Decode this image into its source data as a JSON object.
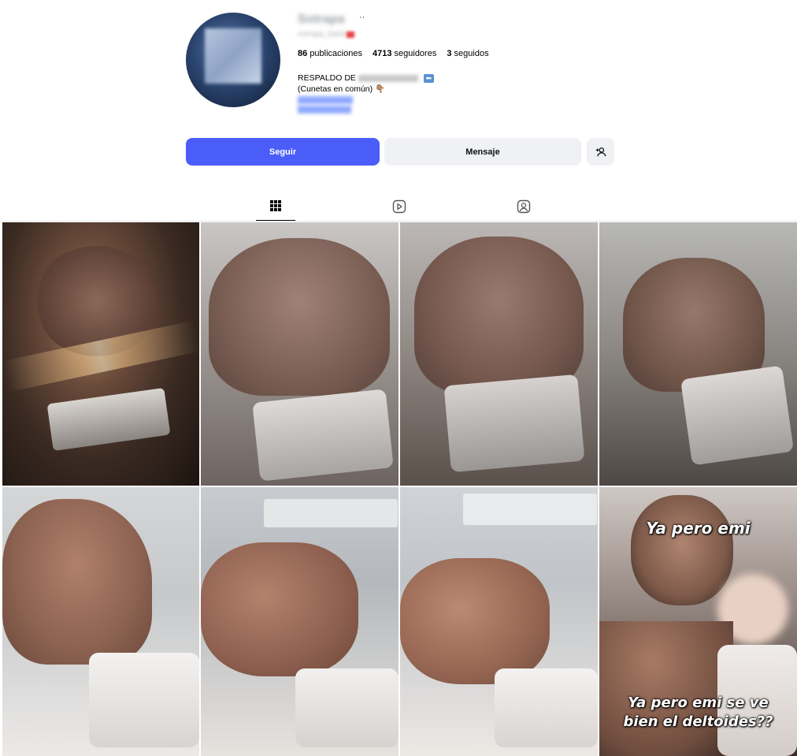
{
  "profile": {
    "username": "Sotrapa",
    "more_icon": "more-dots-icon",
    "handle": "sotrapa_backup",
    "stats": {
      "posts_count": "86",
      "posts_label": "publicaciones",
      "followers_count": "4713",
      "followers_label": "seguidores",
      "following_count": "3",
      "following_label": "seguidos"
    },
    "bio": {
      "line1_prefix": "RESPALDO DE",
      "line1_handle": "@sotrapa_oficial",
      "line2": "(Cunetas en común)",
      "line2_emoji": "👇🏽",
      "links": [
        "link_one",
        "link_two"
      ],
      "line_partial": "(..."
    }
  },
  "actions": {
    "follow_label": "Seguir",
    "message_label": "Mensaje",
    "add_user_icon": "add-user-icon"
  },
  "tabs": [
    {
      "name": "posts",
      "icon": "grid-icon",
      "active": true
    },
    {
      "name": "reels",
      "icon": "reels-icon",
      "active": false
    },
    {
      "name": "tagged",
      "icon": "tagged-icon",
      "active": false
    }
  ],
  "posts": [
    {
      "id": 1,
      "caption": "",
      "palette": [
        "#6a4a3a",
        "#c98a5a",
        "#2a1c16"
      ]
    },
    {
      "id": 2,
      "caption": "",
      "palette": [
        "#8a6a5e",
        "#b8a39b",
        "#4e3e38"
      ]
    },
    {
      "id": 3,
      "caption": "",
      "palette": [
        "#7a5e52",
        "#a89890",
        "#453630"
      ]
    },
    {
      "id": 4,
      "caption": "",
      "palette": [
        "#6e5a52",
        "#b0a8a2",
        "#3c302c"
      ]
    },
    {
      "id": 5,
      "caption": "",
      "palette": [
        "#9a7060",
        "#d8d4d2",
        "#5a4038"
      ]
    },
    {
      "id": 6,
      "caption": "",
      "palette": [
        "#9a7464",
        "#e0dcd8",
        "#5c423a"
      ]
    },
    {
      "id": 7,
      "caption": "",
      "palette": [
        "#a57a66",
        "#dcd8d4",
        "#5e443a"
      ]
    },
    {
      "id": 8,
      "caption_top": "Ya pero emi",
      "caption_bottom": "Ya pero emi se ve bien el deltoides??",
      "palette": [
        "#3e2e28",
        "#d8c8c0",
        "#1a1412"
      ]
    }
  ],
  "colors": {
    "follow_button": "#4a5df9",
    "secondary_button": "#eff1f5",
    "bio_link": "#3d5aff"
  }
}
